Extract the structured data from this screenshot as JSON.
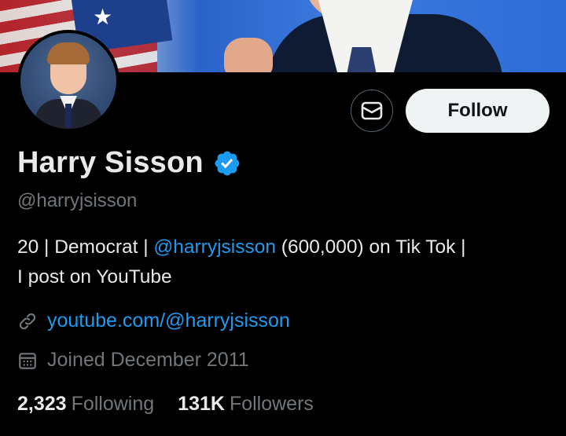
{
  "profile": {
    "name": "Harry Sisson",
    "handle": "@harryjsisson",
    "bio_prefix": "20 | Democrat | ",
    "bio_mention": "@harryjsisson",
    "bio_suffix": " (600,000) on Tik Tok |",
    "bio_line2": "I post on YouTube",
    "website": "youtube.com/@harryjsisson",
    "joined": "Joined December 2011",
    "following_count": "2,323",
    "following_label": "Following",
    "followers_count": "131K",
    "followers_label": "Followers"
  },
  "actions": {
    "follow_label": "Follow",
    "message_icon": "envelope-icon"
  },
  "colors": {
    "background": "#000000",
    "text": "#e7e9ea",
    "muted": "#71767b",
    "link": "#1d9bf0",
    "verified": "#1d9bf0",
    "follow_bg": "#eff3f4"
  }
}
